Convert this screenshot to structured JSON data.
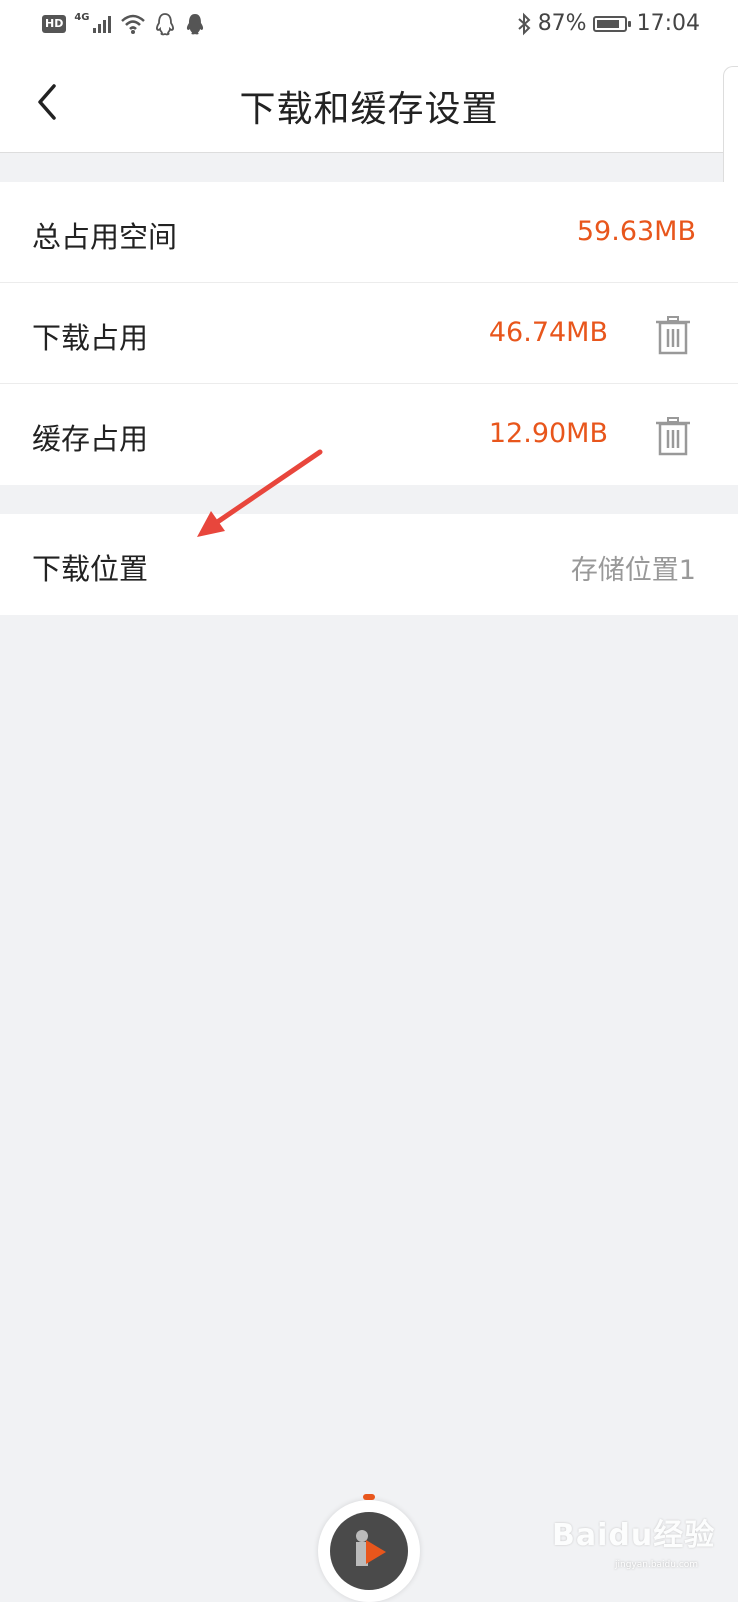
{
  "status_bar": {
    "hd_badge": "HD",
    "network": "4G",
    "battery_text": "87%",
    "battery_level": 0.87,
    "time": "17:04"
  },
  "header": {
    "title": "下载和缓存设置"
  },
  "storage": {
    "total": {
      "label": "总占用空间",
      "value": "59.63MB"
    },
    "download": {
      "label": "下载占用",
      "value": "46.74MB"
    },
    "cache": {
      "label": "缓存占用",
      "value": "12.90MB"
    }
  },
  "download_location": {
    "label": "下载位置",
    "value": "存储位置1"
  },
  "watermark": {
    "text": "Baidu经验",
    "sub": "jingyan.baidu.com"
  },
  "colors": {
    "accent": "#e8561c",
    "background": "#f1f2f4",
    "annotation_arrow": "#e8463c"
  },
  "icons": [
    "back-icon",
    "trash-icon",
    "bluetooth-icon",
    "wifi-icon",
    "signal-icon",
    "qq-icon",
    "battery-icon",
    "play-icon"
  ]
}
